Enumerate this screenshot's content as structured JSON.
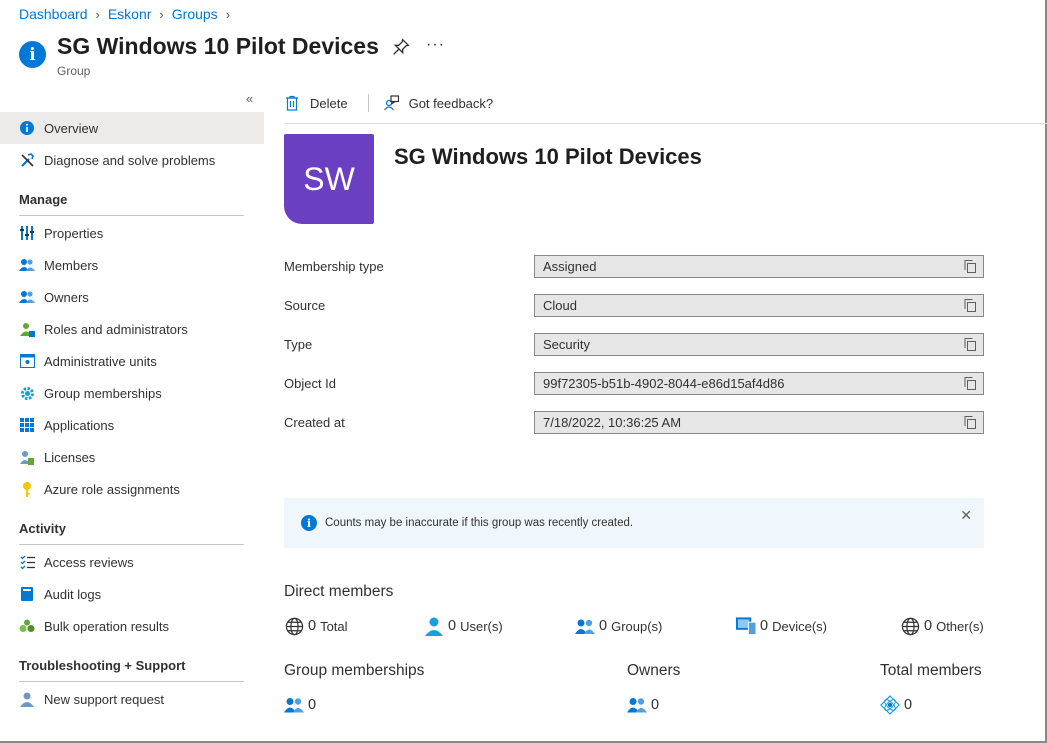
{
  "breadcrumb": [
    "Dashboard",
    "Eskonr",
    "Groups"
  ],
  "header": {
    "title": "SG Windows 10 Pilot Devices",
    "subtitle": "Group"
  },
  "sidebar": {
    "top": [
      {
        "label": "Overview",
        "icon": "info-icon",
        "active": true
      },
      {
        "label": "Diagnose and solve problems",
        "icon": "wrench-icon"
      }
    ],
    "sections": [
      {
        "title": "Manage",
        "items": [
          {
            "label": "Properties",
            "icon": "properties-icon"
          },
          {
            "label": "Members",
            "icon": "members-icon"
          },
          {
            "label": "Owners",
            "icon": "owners-icon"
          },
          {
            "label": "Roles and administrators",
            "icon": "roles-icon"
          },
          {
            "label": "Administrative units",
            "icon": "admin-units-icon"
          },
          {
            "label": "Group memberships",
            "icon": "gear-icon"
          },
          {
            "label": "Applications",
            "icon": "apps-grid-icon"
          },
          {
            "label": "Licenses",
            "icon": "license-icon"
          },
          {
            "label": "Azure role assignments",
            "icon": "key-icon"
          }
        ]
      },
      {
        "title": "Activity",
        "items": [
          {
            "label": "Access reviews",
            "icon": "checklist-icon"
          },
          {
            "label": "Audit logs",
            "icon": "book-icon"
          },
          {
            "label": "Bulk operation results",
            "icon": "bulk-icon"
          }
        ]
      },
      {
        "title": "Troubleshooting + Support",
        "items": [
          {
            "label": "New support request",
            "icon": "support-icon"
          }
        ]
      }
    ]
  },
  "toolbar": {
    "delete": "Delete",
    "feedback": "Got feedback?"
  },
  "avatar": {
    "initials": "SW",
    "color": "#6a3fc1"
  },
  "group_name": "SG Windows 10 Pilot Devices",
  "properties": [
    {
      "label": "Membership type",
      "value": "Assigned"
    },
    {
      "label": "Source",
      "value": "Cloud"
    },
    {
      "label": "Type",
      "value": "Security"
    },
    {
      "label": "Object Id",
      "value": "99f72305-b51b-4902-8044-e86d15af4d86"
    },
    {
      "label": "Created at",
      "value": "7/18/2022, 10:36:25 AM"
    }
  ],
  "banner": {
    "text": "Counts may be inaccurate if this group was recently created."
  },
  "direct_members": {
    "title": "Direct members",
    "stats": [
      {
        "count": "0",
        "label": "Total",
        "icon": "globe-icon"
      },
      {
        "count": "0",
        "label": "User(s)",
        "icon": "user-icon"
      },
      {
        "count": "0",
        "label": "Group(s)",
        "icon": "group-icon"
      },
      {
        "count": "0",
        "label": "Device(s)",
        "icon": "device-icon"
      },
      {
        "count": "0",
        "label": "Other(s)",
        "icon": "globe-icon"
      }
    ]
  },
  "summary": [
    {
      "title": "Group memberships",
      "count": "0",
      "icon": "group-icon"
    },
    {
      "title": "Owners",
      "count": "0",
      "icon": "group-icon"
    },
    {
      "title": "Total members",
      "count": "0",
      "icon": "network-icon"
    }
  ],
  "colors": {
    "accent": "#0078d4",
    "avatar": "#6a3fc1",
    "banner": "#eff6fc"
  }
}
